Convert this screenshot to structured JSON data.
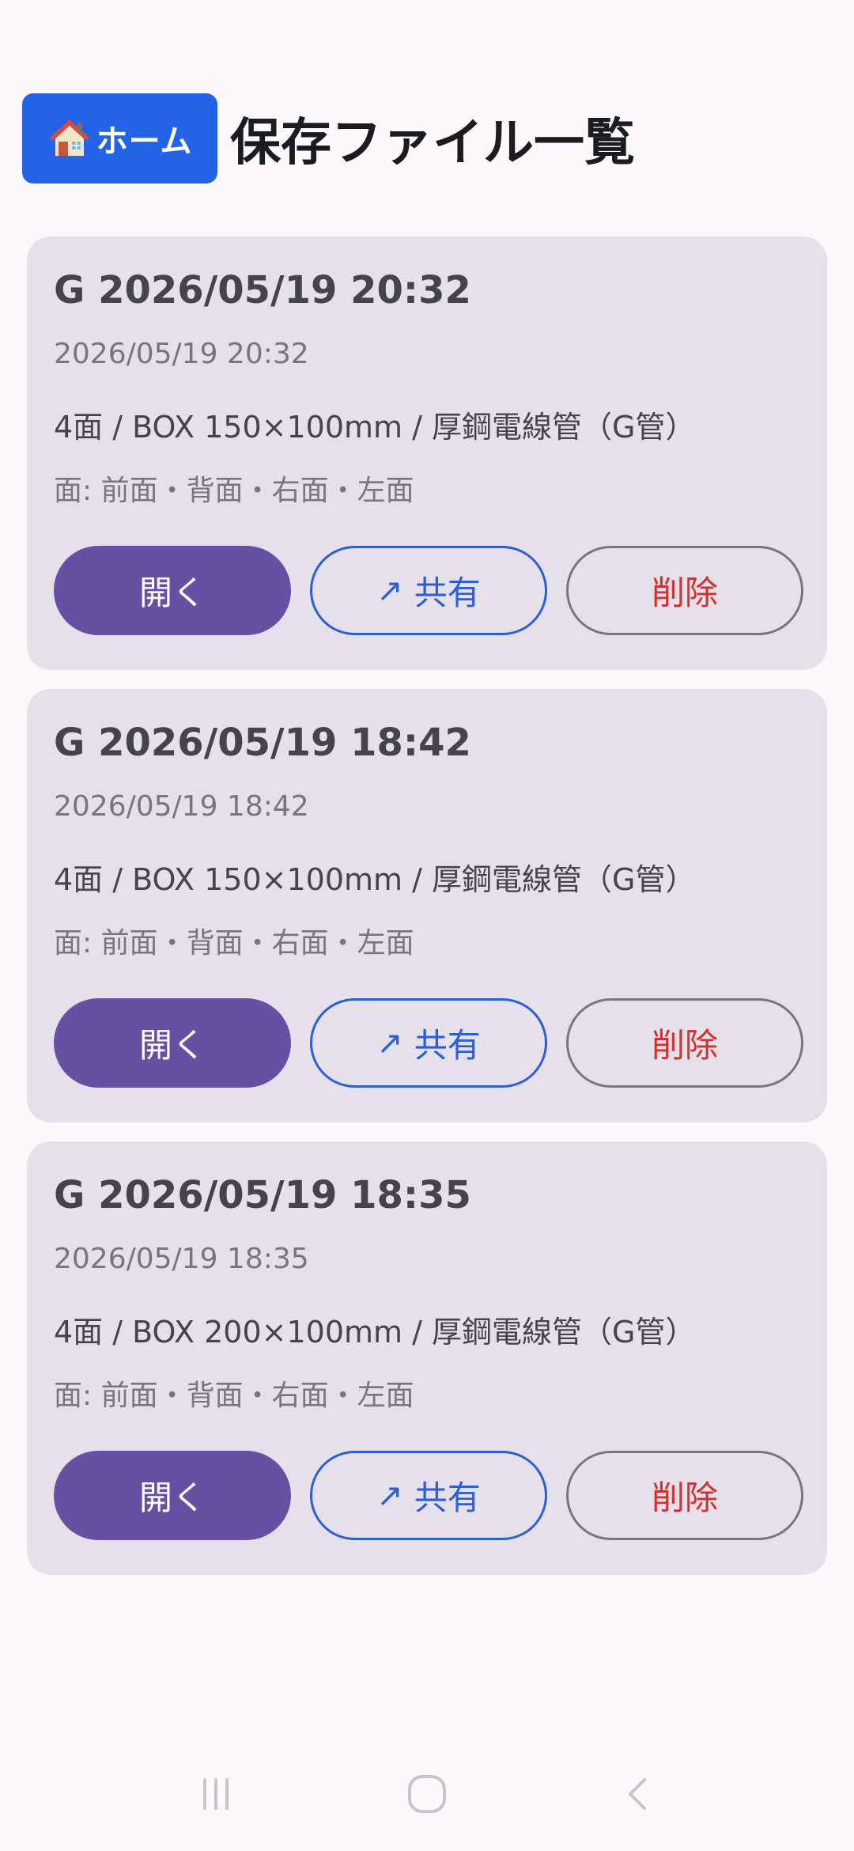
{
  "header": {
    "home_label": "ホーム",
    "title": "保存ファイル一覧"
  },
  "files": [
    {
      "title": "G 2026/05/19 20:32",
      "date": "2026/05/19 20:32",
      "spec": "4面 / BOX 150×100mm / 厚鋼電線管（G管）",
      "faces": "面: 前面・背面・右面・左面"
    },
    {
      "title": "G 2026/05/19 18:42",
      "date": "2026/05/19 18:42",
      "spec": "4面 / BOX 150×100mm / 厚鋼電線管（G管）",
      "faces": "面: 前面・背面・右面・左面"
    },
    {
      "title": "G 2026/05/19 18:35",
      "date": "2026/05/19 18:35",
      "spec": "4面 / BOX 200×100mm / 厚鋼電線管（G管）",
      "faces": "面: 前面・背面・右面・左面"
    }
  ],
  "actions": {
    "open_label": "開く",
    "share_icon": "↗",
    "share_label": "共有",
    "delete_label": "削除"
  },
  "nav": {
    "icons": [
      "recent-apps-icon",
      "home-icon",
      "back-icon"
    ]
  },
  "colors": {
    "home_button": "#2463e6",
    "card_background": "#e6e0ea",
    "open_button": "#6750a4",
    "share_accent": "#2c5fd6",
    "delete_text": "#d32f2f"
  }
}
